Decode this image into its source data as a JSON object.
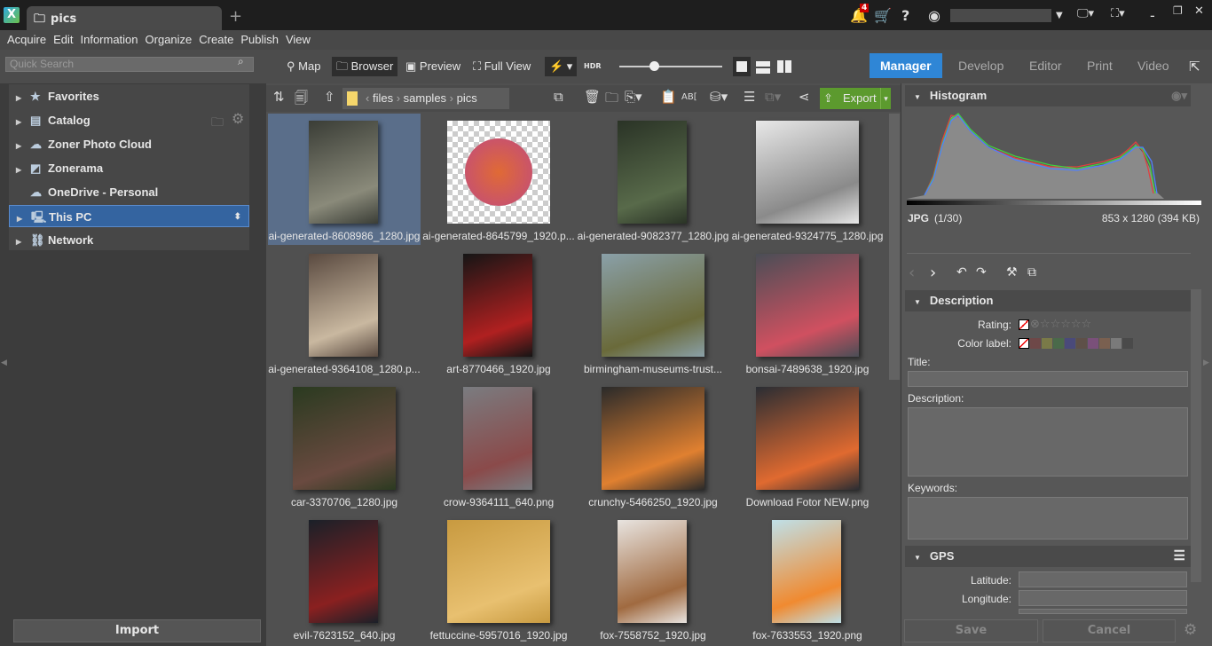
{
  "app": {
    "tab_title": "pics",
    "notifications": "4"
  },
  "menu": [
    "Acquire",
    "Edit",
    "Information",
    "Organize",
    "Create",
    "Publish",
    "View"
  ],
  "search": {
    "placeholder": "Quick Search"
  },
  "views": {
    "map": "Map",
    "browser": "Browser",
    "preview": "Preview",
    "full_view": "Full View",
    "hdr": "HDR"
  },
  "modes": {
    "manager": "Manager",
    "develop": "Develop",
    "editor": "Editor",
    "print": "Print",
    "video": "Video",
    "active": "Manager"
  },
  "tree": [
    {
      "label": "Favorites",
      "icon": "star-icon"
    },
    {
      "label": "Catalog",
      "icon": "catalog-icon"
    },
    {
      "label": "Zoner Photo Cloud",
      "icon": "cloud-icon"
    },
    {
      "label": "Zonerama",
      "icon": "zonerama-icon"
    },
    {
      "label": "OneDrive - Personal",
      "icon": "onedrive-icon"
    },
    {
      "label": "This PC",
      "icon": "computer-icon",
      "selected": true
    },
    {
      "label": "Network",
      "icon": "network-icon"
    }
  ],
  "import_label": "Import",
  "breadcrumb": [
    "files",
    "samples",
    "pics"
  ],
  "export_label": "Export",
  "files": [
    {
      "name": "ai-generated-8608986_1280.jpg",
      "colors": [
        "#3a3d36",
        "#8a8a7a"
      ],
      "orient": "p",
      "selected": true
    },
    {
      "name": "ai-generated-8645799_1920.p...",
      "colors": [
        "#d9d9d9",
        "#e06a35"
      ],
      "orient": "l"
    },
    {
      "name": "ai-generated-9082377_1280.jpg",
      "colors": [
        "#2a3326",
        "#586a4a"
      ],
      "orient": "p"
    },
    {
      "name": "ai-generated-9324775_1280.jpg",
      "colors": [
        "#e8e8e8",
        "#8a8a8a"
      ],
      "orient": "l"
    },
    {
      "name": "ai-generated-9364108_1280.p...",
      "colors": [
        "#5a4a40",
        "#c9b8a0"
      ],
      "orient": "p"
    },
    {
      "name": "art-8770466_1920.jpg",
      "colors": [
        "#151515",
        "#b02020"
      ],
      "orient": "p"
    },
    {
      "name": "birmingham-museums-trust...",
      "colors": [
        "#8aa0a8",
        "#6a6a3a"
      ],
      "orient": "l"
    },
    {
      "name": "bonsai-7489638_1920.jpg",
      "colors": [
        "#4a4e56",
        "#d05060"
      ],
      "orient": "l"
    },
    {
      "name": "car-3370706_1280.jpg",
      "colors": [
        "#2a3a20",
        "#6a4a40"
      ],
      "orient": "l"
    },
    {
      "name": "crow-9364111_640.png",
      "colors": [
        "#7a7c80",
        "#8a4a4a"
      ],
      "orient": "p"
    },
    {
      "name": "crunchy-5466250_1920.jpg",
      "colors": [
        "#2a2a2a",
        "#e08030"
      ],
      "orient": "l"
    },
    {
      "name": "Download Fotor NEW.png",
      "colors": [
        "#2a2d33",
        "#e06a30"
      ],
      "orient": "l"
    },
    {
      "name": "evil-7623152_640.jpg",
      "colors": [
        "#1a2028",
        "#8a2020"
      ],
      "orient": "p"
    },
    {
      "name": "fettuccine-5957016_1920.jpg",
      "colors": [
        "#c89a40",
        "#e8c070"
      ],
      "orient": "l"
    },
    {
      "name": "fox-7558752_1920.jpg",
      "colors": [
        "#e8e4e0",
        "#a06a40"
      ],
      "orient": "p"
    },
    {
      "name": "fox-7633553_1920.png",
      "colors": [
        "#bfe0e8",
        "#f08a30"
      ],
      "orient": "p"
    }
  ],
  "histogram": {
    "title": "Histogram",
    "format": "JPG",
    "index": "(1/30)",
    "dimensions": "853 x 1280 (394 KB)"
  },
  "description": {
    "title": "Description",
    "rating_label": "Rating:",
    "rating": 0,
    "color_label": "Color label:",
    "label_colors": [
      "#6e4848",
      "#7a7a48",
      "#4a6a4a",
      "#4a4a7a",
      "#5e5048",
      "#7a507a",
      "#7a6050",
      "#7a7a7a",
      "#4a4a4a"
    ],
    "title_label": "Title:",
    "description_label": "Description:",
    "keywords_label": "Keywords:"
  },
  "gps": {
    "title": "GPS",
    "latitude_label": "Latitude:",
    "longitude_label": "Longitude:"
  },
  "buttons": {
    "save": "Save",
    "cancel": "Cancel"
  }
}
